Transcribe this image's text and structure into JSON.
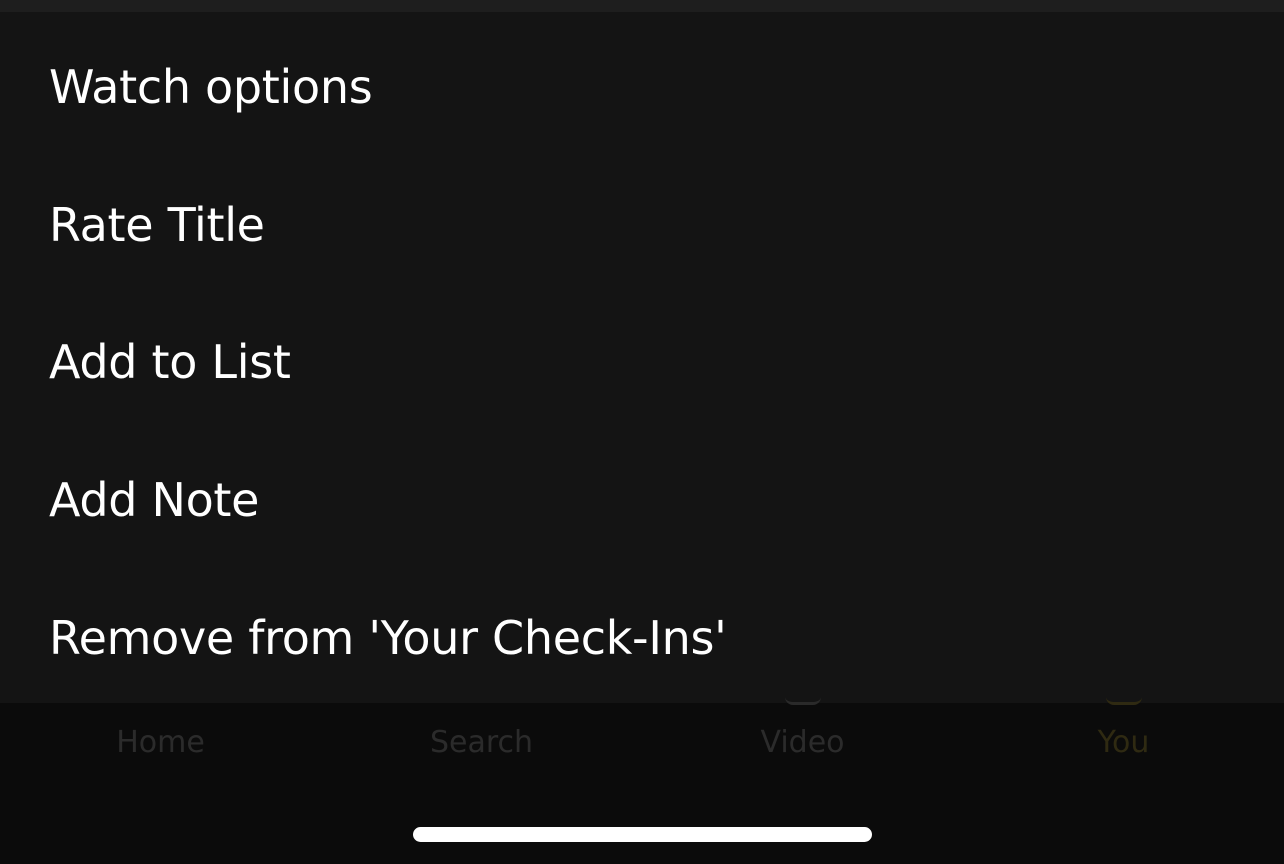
{
  "action_sheet": {
    "items": [
      {
        "label": "Watch options"
      },
      {
        "label": "Rate Title"
      },
      {
        "label": "Add to List"
      },
      {
        "label": "Add Note"
      },
      {
        "label": "Remove from 'Your Check-Ins'"
      }
    ]
  },
  "tab_bar": {
    "tabs": [
      {
        "label": "Home",
        "icon": "home-icon"
      },
      {
        "label": "Search",
        "icon": "search-icon"
      },
      {
        "label": "Video",
        "icon": "video-icon"
      },
      {
        "label": "You",
        "icon": "profile-icon",
        "active": true
      }
    ]
  },
  "colors": {
    "sheet_background": "#141414",
    "item_text": "#ffffff",
    "tab_inactive": "#2b2b2b",
    "tab_active": "#2f2a12"
  }
}
